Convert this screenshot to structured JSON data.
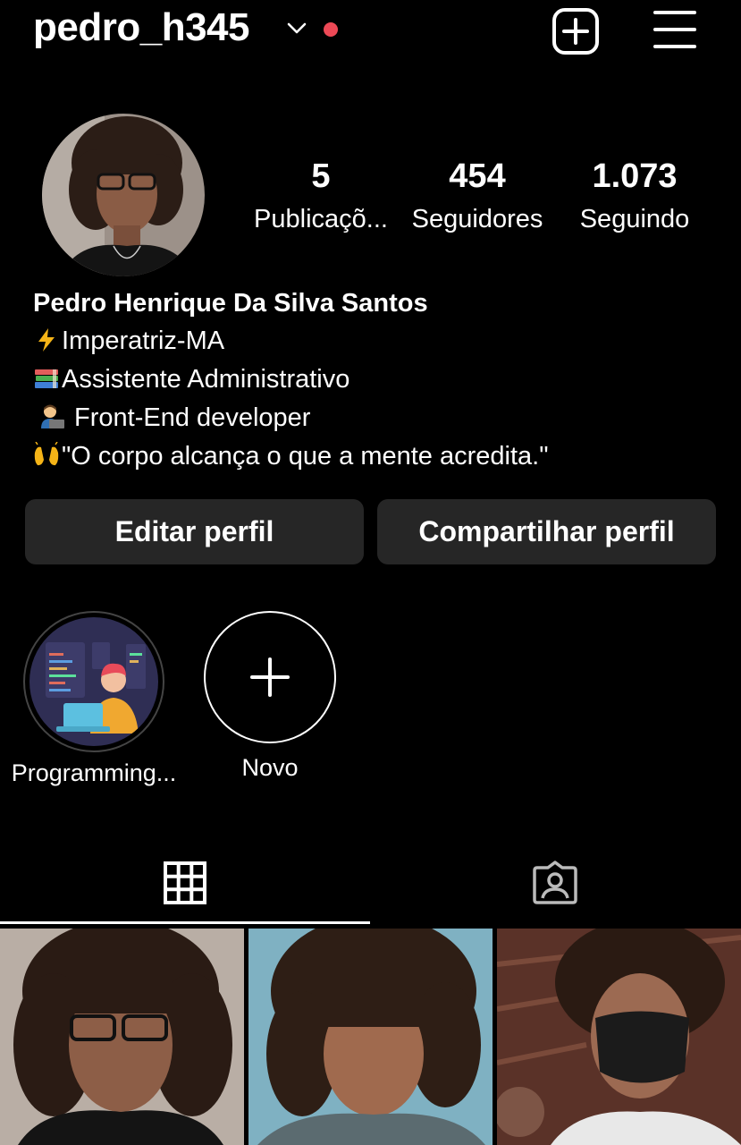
{
  "header": {
    "username": "pedro_h345",
    "notification_color": "#ed4956"
  },
  "profile": {
    "stats": [
      {
        "value": "5",
        "label": "Publicaçõ..."
      },
      {
        "value": "454",
        "label": "Seguidores"
      },
      {
        "value": "1.073",
        "label": "Seguindo"
      }
    ],
    "name": "Pedro Henrique Da Silva Santos",
    "bio": [
      {
        "icon": "lightning-emoji",
        "text": "Imperatriz-MA"
      },
      {
        "icon": "books-emoji",
        "text": "Assistente Administrativo"
      },
      {
        "icon": "technologist-emoji",
        "text": " Front-End developer"
      },
      {
        "icon": "raising-hands-emoji",
        "text": "\"O corpo alcança o que a mente acredita.\""
      }
    ]
  },
  "actions": {
    "edit_label": "Editar perfil",
    "share_label": "Compartilhar perfil"
  },
  "highlights": [
    {
      "label": "Programming..."
    },
    {
      "label": "Novo"
    }
  ],
  "tabs": [
    {
      "icon": "grid-icon",
      "active": true
    },
    {
      "icon": "tagged-icon",
      "active": false
    }
  ],
  "colors": {
    "background": "#000000",
    "button": "#262626",
    "accent": "#ed4956"
  }
}
